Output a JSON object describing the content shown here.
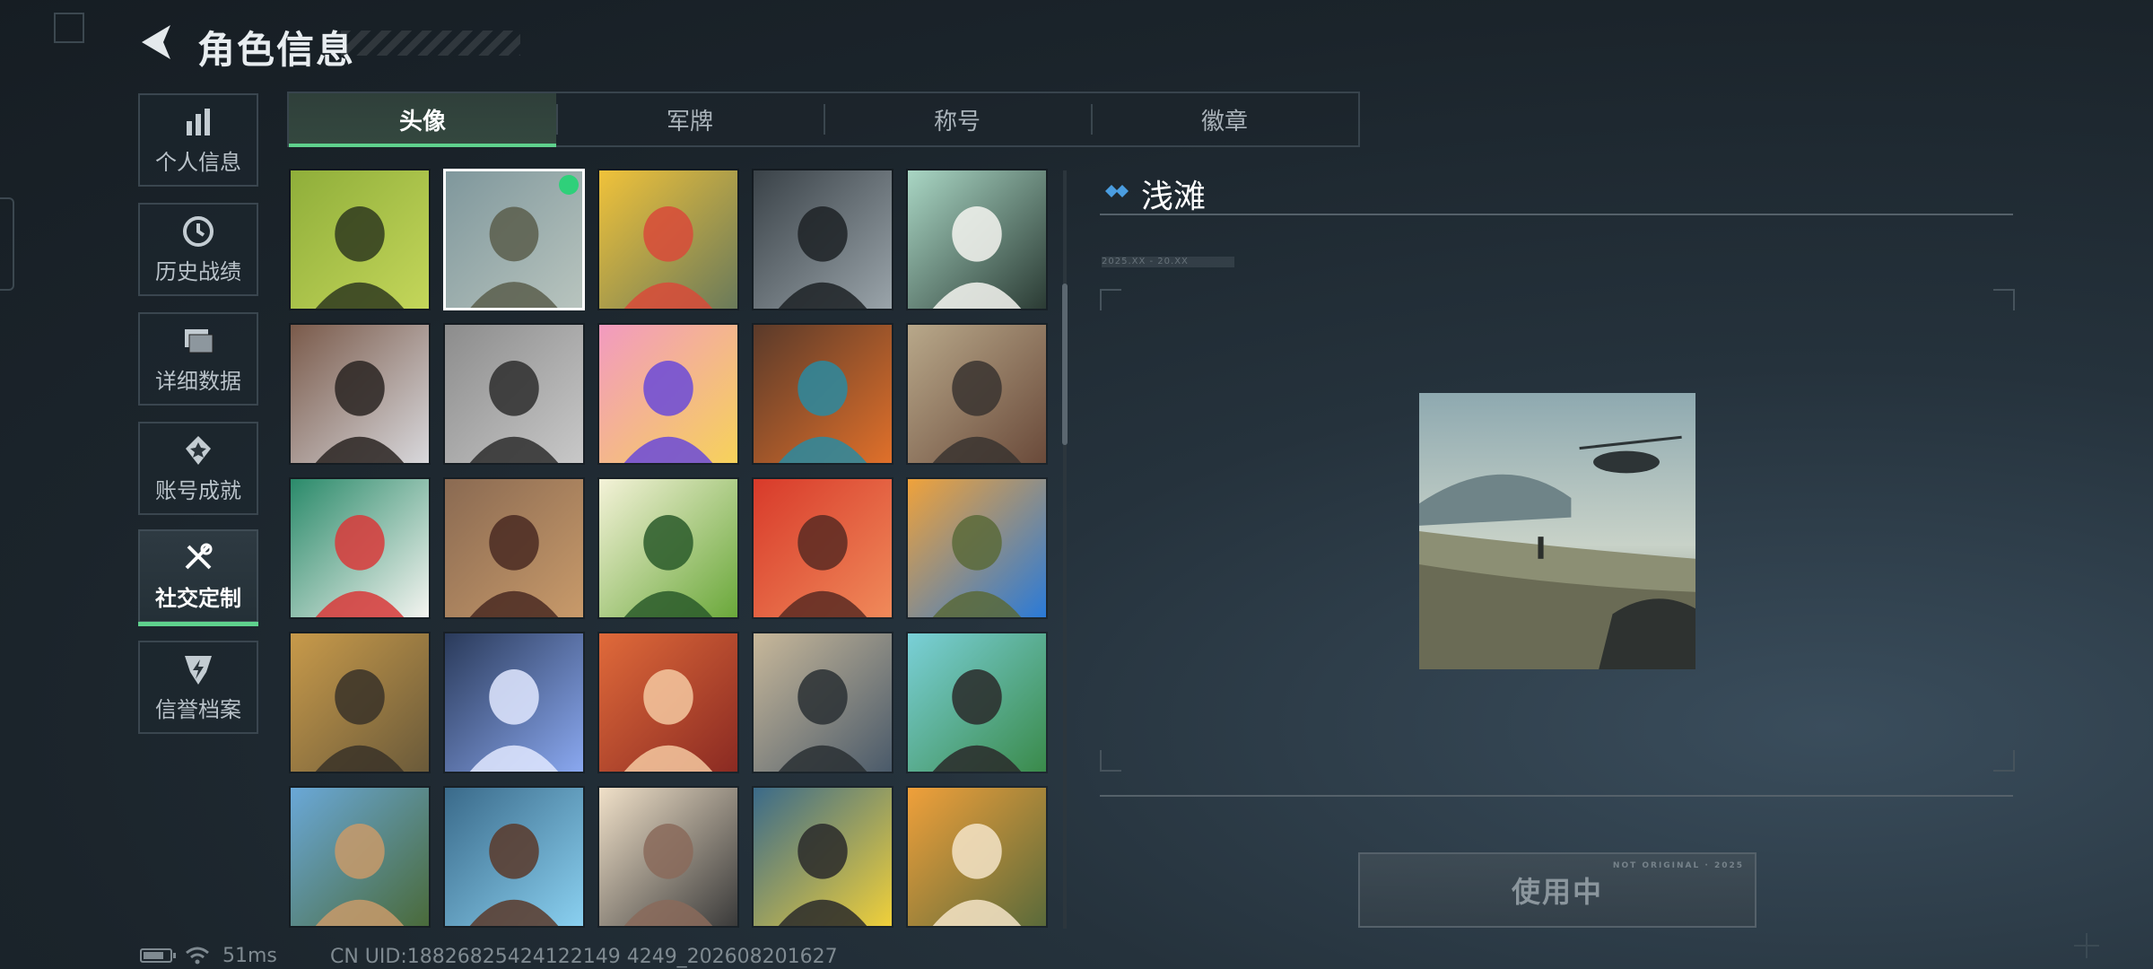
{
  "header": {
    "title": "角色信息"
  },
  "sidebar": {
    "items": [
      {
        "label": "个人信息",
        "icon": "bar-chart-icon"
      },
      {
        "label": "历史战绩",
        "icon": "clock-icon"
      },
      {
        "label": "详细数据",
        "icon": "folder-icon"
      },
      {
        "label": "账号成就",
        "icon": "medal-icon"
      },
      {
        "label": "社交定制",
        "icon": "tools-icon",
        "active": true
      },
      {
        "label": "信誉档案",
        "icon": "shield-icon"
      }
    ]
  },
  "tabs": [
    {
      "label": "头像",
      "active": true
    },
    {
      "label": "军牌"
    },
    {
      "label": "称号"
    },
    {
      "label": "徽章"
    }
  ],
  "avatars": [
    {
      "icon": "exit-door-avatar"
    },
    {
      "icon": "beach-helicopter-avatar",
      "selected": true
    },
    {
      "icon": "soldier-emoji-avatar"
    },
    {
      "icon": "girl-portrait-avatar"
    },
    {
      "icon": "way-out-sign-avatar"
    },
    {
      "icon": "fist-avatar"
    },
    {
      "icon": "smoke-soldier-avatar"
    },
    {
      "icon": "anime-girl-avatar"
    },
    {
      "icon": "feather-avatar"
    },
    {
      "icon": "rusty-truck-avatar"
    },
    {
      "icon": "snowman-avatar"
    },
    {
      "icon": "scales-emblem-avatar"
    },
    {
      "icon": "crocodile-avatar"
    },
    {
      "icon": "heart-soup-avatar"
    },
    {
      "icon": "bearded-man-avatar"
    },
    {
      "icon": "soldier-gun-avatar"
    },
    {
      "icon": "suit-man-avatar"
    },
    {
      "icon": "red-hair-woman-avatar"
    },
    {
      "icon": "mountain-view-avatar"
    },
    {
      "icon": "beach-relax-avatar"
    },
    {
      "icon": "thumbs-up-avatar"
    },
    {
      "icon": "archer-avatar"
    },
    {
      "icon": "woman-coffee-avatar"
    },
    {
      "icon": "alligator-sign-avatar"
    },
    {
      "icon": "dog-soldier-avatar"
    }
  ],
  "detail": {
    "name": "浅滩",
    "date_range": "2025.XX - 20.XX",
    "button_label": "使用中",
    "button_deco": "NOT ORIGINAL · 2025"
  },
  "status": {
    "ping": "51ms",
    "uid": "CN UID:18826825424122149 4249_202608201627"
  },
  "colors": {
    "accent": "#5fd18d",
    "badge": "#2fd07a",
    "diamond": "#4a9de0"
  }
}
